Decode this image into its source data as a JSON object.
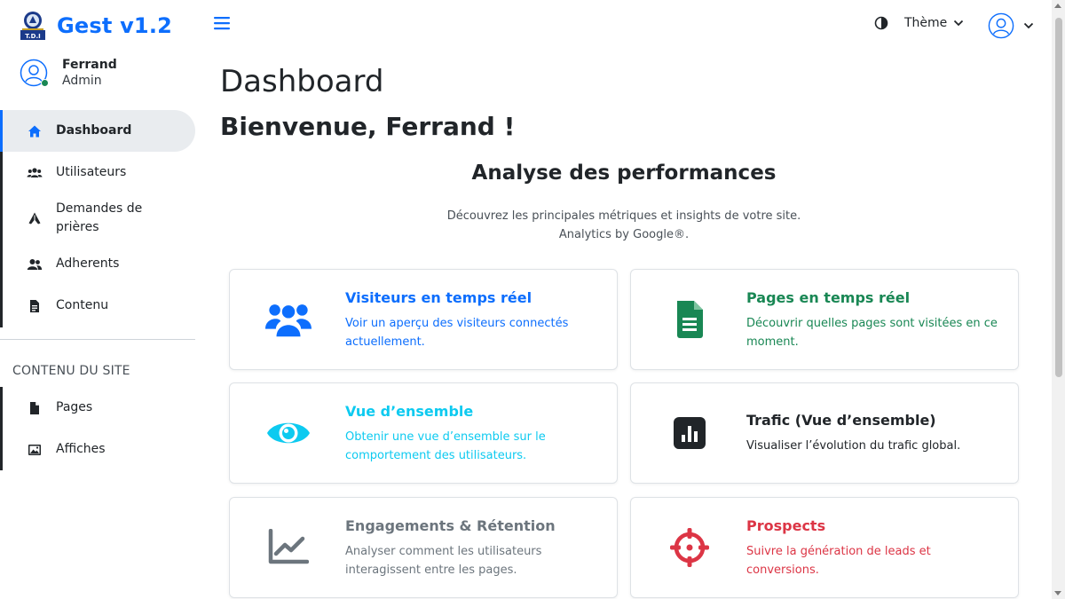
{
  "brand": {
    "title": "Gest v1.2",
    "logo_caption": "T.D.I",
    "logo_icon": "church-logo-icon"
  },
  "user": {
    "name": "Ferrand",
    "role": "Admin",
    "status_color": "#198754"
  },
  "nav": {
    "items": [
      {
        "label": "Dashboard",
        "icon": "home-icon",
        "active": true
      },
      {
        "label": "Utilisateurs",
        "icon": "users-icon"
      },
      {
        "label": "Demandes de prières",
        "icon": "praying-hands-icon"
      },
      {
        "label": "Adherents",
        "icon": "user-group-icon"
      },
      {
        "label": "Contenu",
        "icon": "document-icon"
      }
    ],
    "section_title": "CONTENU DU SITE",
    "section_items": [
      {
        "label": "Pages",
        "icon": "file-icon"
      },
      {
        "label": "Affiches",
        "icon": "image-icon"
      }
    ]
  },
  "topbar": {
    "theme_label": "Thème",
    "menu_icon": "hamburger-icon",
    "theme_icon": "contrast-icon",
    "account_icon": "user-circle-icon"
  },
  "main": {
    "title": "Dashboard",
    "welcome_prefix": "Bienvenue, ",
    "welcome_name": "Ferrand",
    "welcome_suffix": " !",
    "analysis_title": "Analyse des performances",
    "subtitle_line1": "Découvrez les principales métriques et insights de votre site.",
    "subtitle_line2": "Analytics by Google®."
  },
  "cards": [
    {
      "title": "Visiteurs en temps réel",
      "desc": "Voir un aperçu des visiteurs connectés actuellement.",
      "icon": "users-icon",
      "color": "#0d6efd"
    },
    {
      "title": "Pages en temps réel",
      "desc": "Découvrir quelles pages sont visitées en ce moment.",
      "icon": "sheet-icon",
      "color": "#198754"
    },
    {
      "title": "Vue d’ensemble",
      "desc": "Obtenir une vue d’ensemble sur le comportement des utilisateurs.",
      "icon": "eye-icon",
      "color": "#0dcaf0"
    },
    {
      "title": "Trafic (Vue d’ensemble)",
      "desc": "Visualiser l’évolution du trafic global.",
      "icon": "bar-chart-icon",
      "color": "#212529"
    },
    {
      "title": "Engagements & Rétention",
      "desc": "Analyser comment les utilisateurs interagissent entre les pages.",
      "icon": "line-chart-icon",
      "color": "#6c757d"
    },
    {
      "title": "Prospects",
      "desc": "Suivre la génération de leads et conversions.",
      "icon": "crosshair-icon",
      "color": "#dc3545"
    }
  ],
  "colors": {
    "accent": "#0d6efd",
    "active_bg": "#e9ecef"
  }
}
